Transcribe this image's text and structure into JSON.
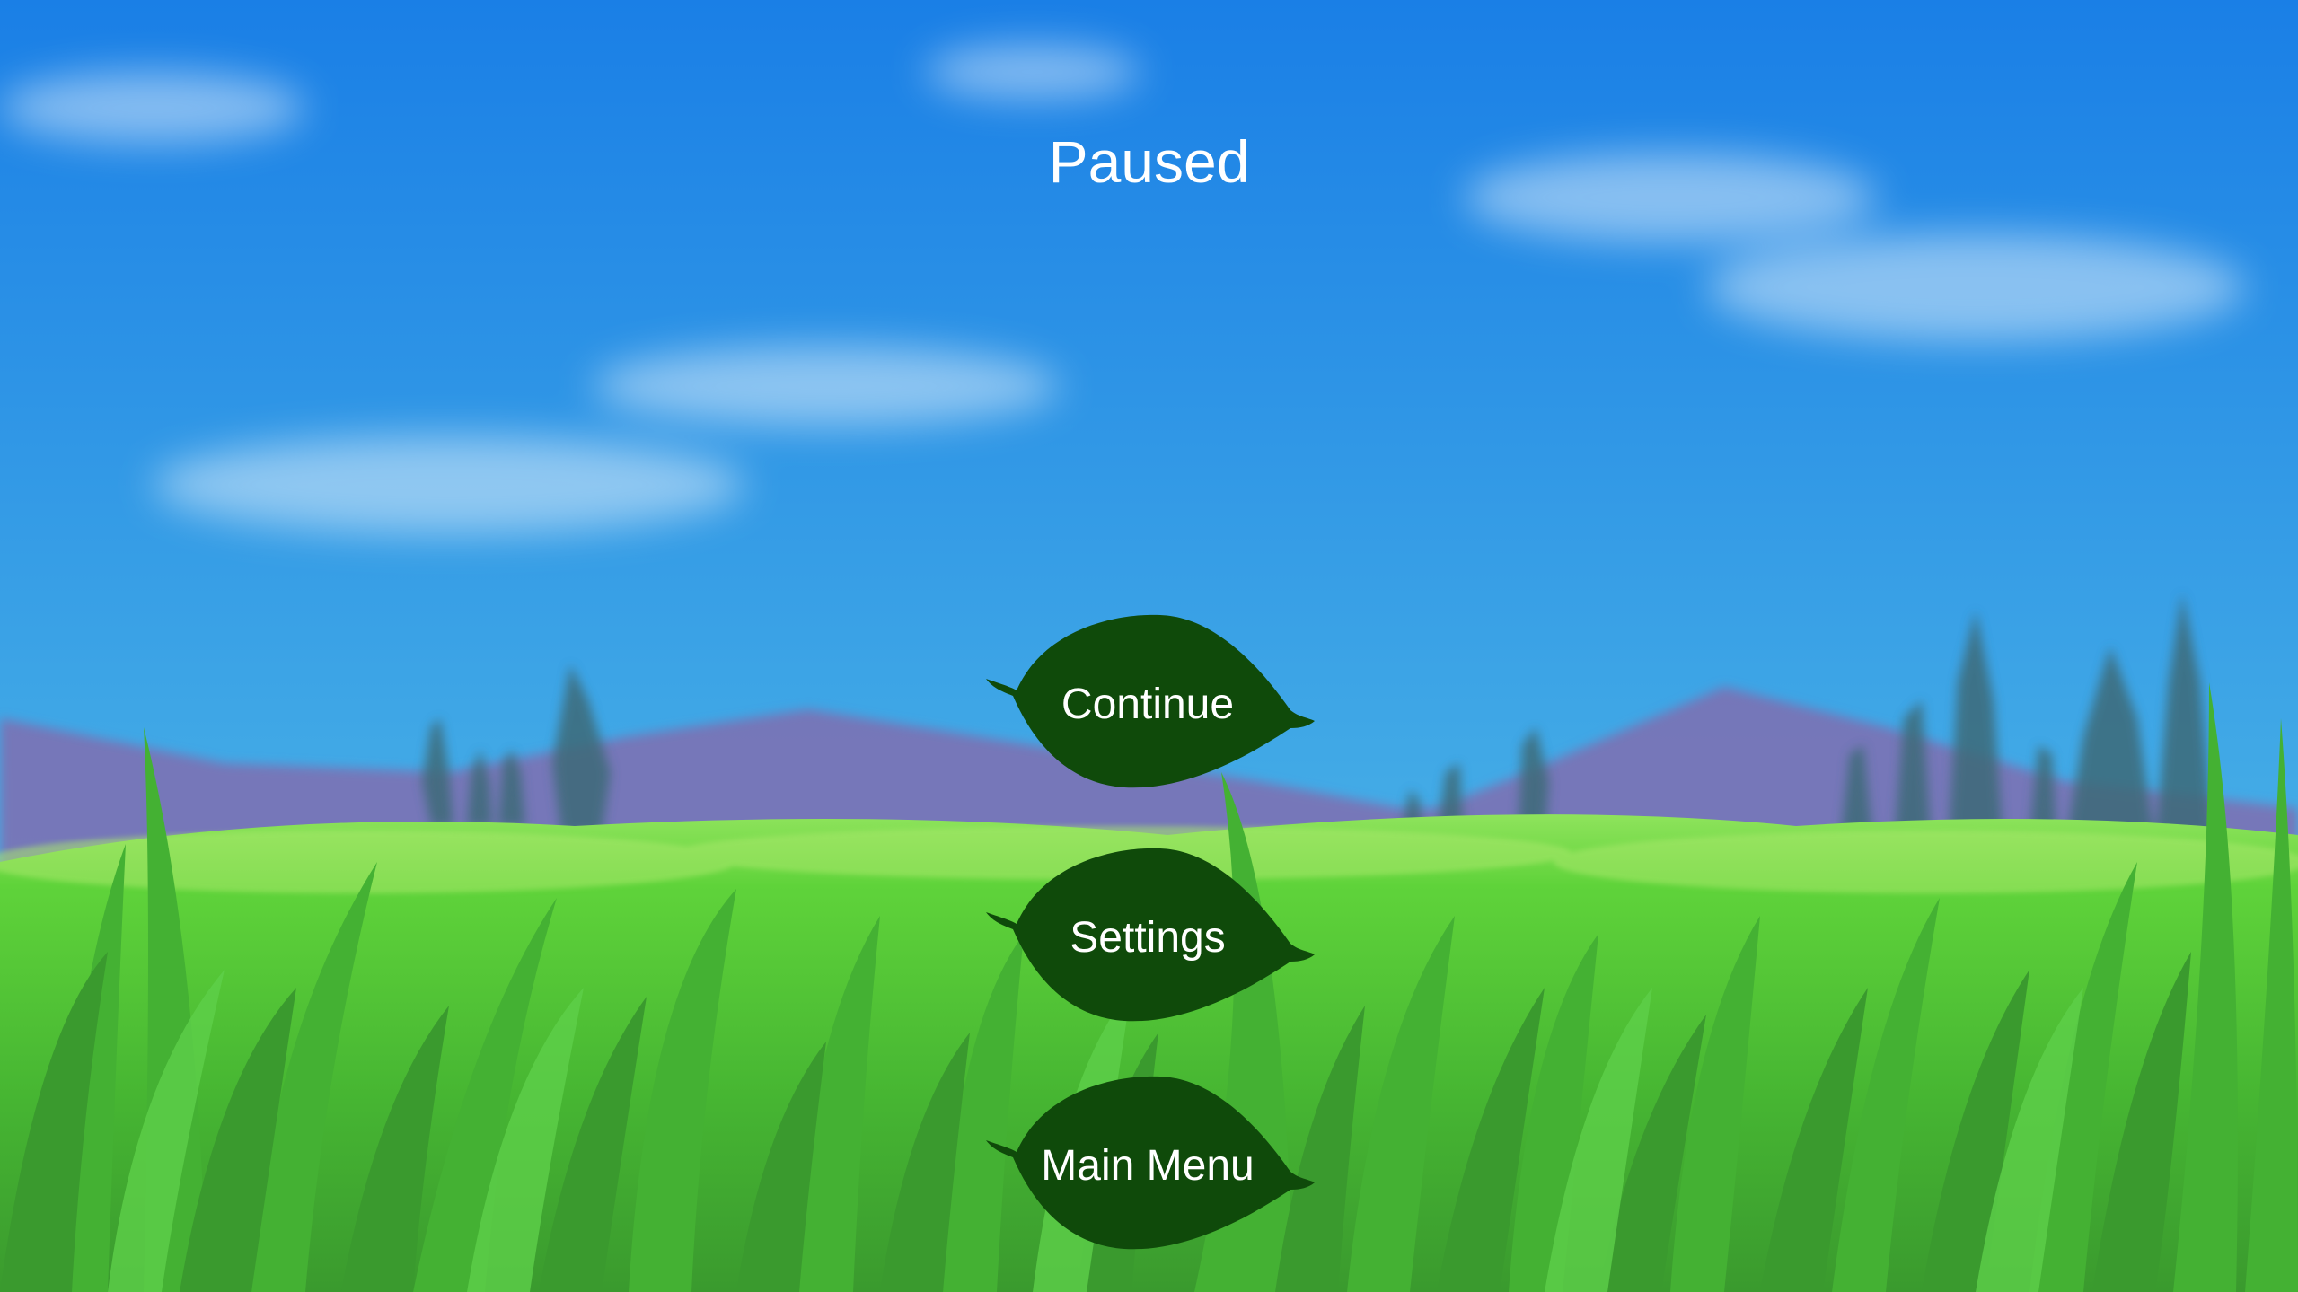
{
  "pause_menu": {
    "title": "Paused",
    "buttons": {
      "continue": "Continue",
      "settings": "Settings",
      "main_menu": "Main Menu"
    }
  },
  "colors": {
    "sky_top": "#1a7fe6",
    "sky_bottom": "#4ab3e8",
    "mountain": "#7f6fb0",
    "grass_light": "#5fd33a",
    "grass_dark": "#3a9a2e",
    "leaf_button": "#0f4a0a",
    "text": "#ffffff"
  },
  "icons": {
    "button_shape": "leaf-icon"
  }
}
